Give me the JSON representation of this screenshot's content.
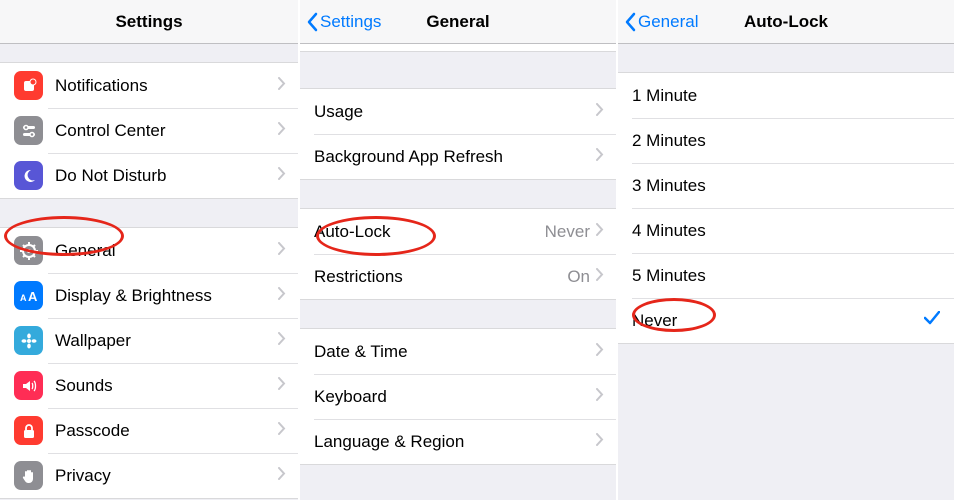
{
  "col1": {
    "title": "Settings",
    "group1": [
      {
        "name": "notifications",
        "label": "Notifications",
        "iconBg": "bg-red"
      },
      {
        "name": "control-center",
        "label": "Control Center",
        "iconBg": "bg-gray"
      },
      {
        "name": "do-not-disturb",
        "label": "Do Not Disturb",
        "iconBg": "bg-purple"
      }
    ],
    "group2": [
      {
        "name": "general",
        "label": "General",
        "iconBg": "bg-gray"
      },
      {
        "name": "display-brightness",
        "label": "Display & Brightness",
        "iconBg": "bg-blue"
      },
      {
        "name": "wallpaper",
        "label": "Wallpaper",
        "iconBg": "bg-cyan"
      },
      {
        "name": "sounds",
        "label": "Sounds",
        "iconBg": "bg-redpink"
      },
      {
        "name": "passcode",
        "label": "Passcode",
        "iconBg": "bg-red"
      },
      {
        "name": "privacy",
        "label": "Privacy",
        "iconBg": "bg-gray2"
      }
    ]
  },
  "col2": {
    "back": "Settings",
    "title": "General",
    "group1": [
      {
        "name": "usage",
        "label": "Usage"
      },
      {
        "name": "background-app-refresh",
        "label": "Background App Refresh"
      }
    ],
    "group2": [
      {
        "name": "auto-lock",
        "label": "Auto-Lock",
        "value": "Never"
      },
      {
        "name": "restrictions",
        "label": "Restrictions",
        "value": "On"
      }
    ],
    "group3": [
      {
        "name": "date-time",
        "label": "Date & Time"
      },
      {
        "name": "keyboard",
        "label": "Keyboard"
      },
      {
        "name": "language-region",
        "label": "Language & Region"
      }
    ]
  },
  "col3": {
    "back": "General",
    "title": "Auto-Lock",
    "options": [
      {
        "name": "1-minute",
        "label": "1 Minute",
        "selected": false
      },
      {
        "name": "2-minutes",
        "label": "2 Minutes",
        "selected": false
      },
      {
        "name": "3-minutes",
        "label": "3 Minutes",
        "selected": false
      },
      {
        "name": "4-minutes",
        "label": "4 Minutes",
        "selected": false
      },
      {
        "name": "5-minutes",
        "label": "5 Minutes",
        "selected": false
      },
      {
        "name": "never",
        "label": "Never",
        "selected": true
      }
    ]
  }
}
